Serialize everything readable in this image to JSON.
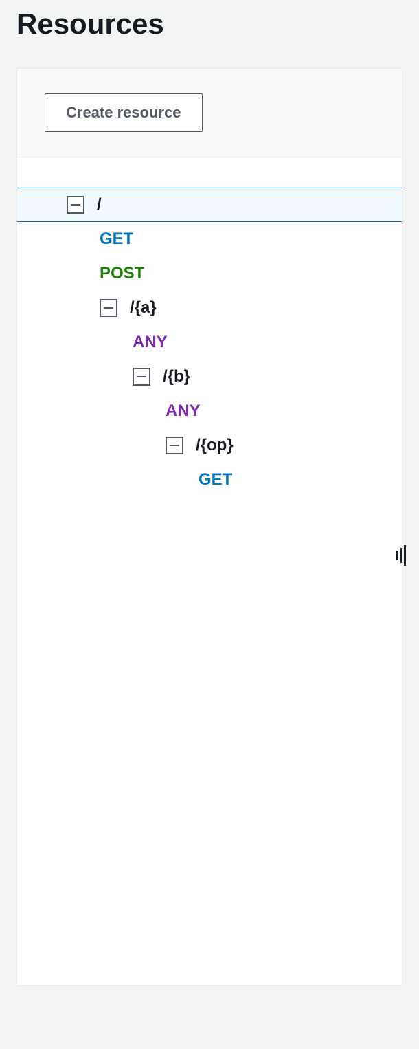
{
  "title": "Resources",
  "create_button": "Create resource",
  "tree": {
    "root": {
      "path": "/"
    },
    "root_get": {
      "method": "GET"
    },
    "root_post": {
      "method": "POST"
    },
    "a": {
      "path": "/{a}"
    },
    "a_any": {
      "method": "ANY"
    },
    "b": {
      "path": "/{b}"
    },
    "b_any": {
      "method": "ANY"
    },
    "op": {
      "path": "/{op}"
    },
    "op_get": {
      "method": "GET"
    }
  }
}
